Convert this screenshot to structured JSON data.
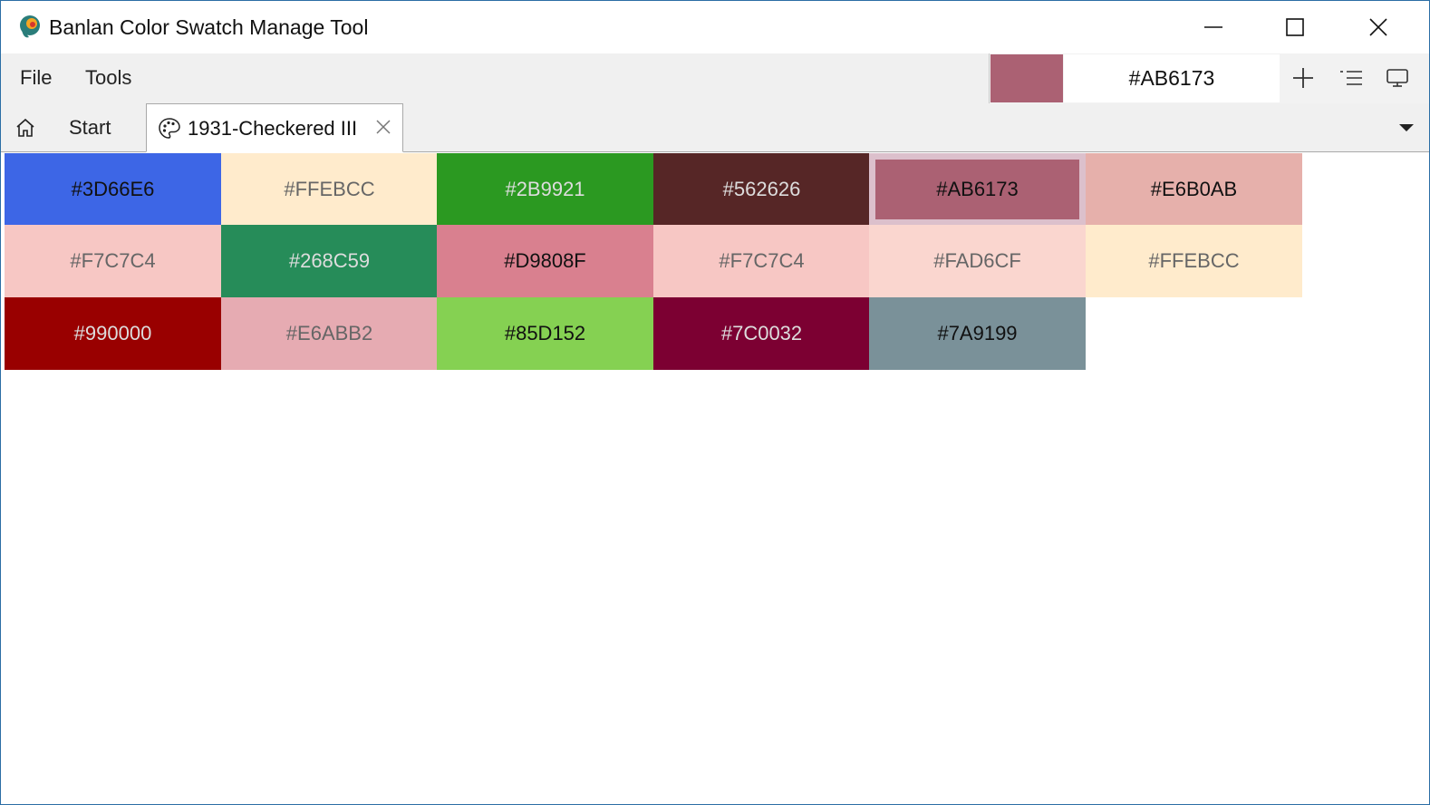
{
  "window": {
    "title": "Banlan Color Swatch Manage Tool",
    "icon": "banlan-logo-icon",
    "controls": [
      "minimize-icon",
      "maximize-icon",
      "close-icon"
    ]
  },
  "menu": {
    "file": "File",
    "tools": "Tools"
  },
  "toolbar": {
    "current_color": "#AB6173",
    "hex_value": "#AB6173",
    "icons": [
      "add-icon",
      "list-view-icon",
      "display-icon"
    ]
  },
  "tabs": {
    "start": {
      "label": "Start",
      "icon": "home-icon"
    },
    "active": {
      "label": "1931-Checkered III",
      "icon": "palette-icon",
      "close": "close-tab-icon"
    },
    "dropdown": "chevron-down-icon"
  },
  "swatches": [
    {
      "hex": "#3D66E6",
      "bg": "#3D66E6",
      "fg": "#111111"
    },
    {
      "hex": "#FFEBCC",
      "bg": "#FFEBCC",
      "fg": "#666666"
    },
    {
      "hex": "#2B9921",
      "bg": "#2B9921",
      "fg": "#dddddd"
    },
    {
      "hex": "#562626",
      "bg": "#562626",
      "fg": "#dddddd"
    },
    {
      "hex": "#AB6173",
      "bg": "#AB6173",
      "fg": "#111111",
      "selected": true
    },
    {
      "hex": "#E6B0AB",
      "bg": "#E6B0AB",
      "fg": "#111111"
    },
    {
      "hex": "#F7C7C4",
      "bg": "#F7C7C4",
      "fg": "#666666"
    },
    {
      "hex": "#268C59",
      "bg": "#268C59",
      "fg": "#dddddd"
    },
    {
      "hex": "#D9808F",
      "bg": "#D9808F",
      "fg": "#111111"
    },
    {
      "hex": "#F7C7C4",
      "bg": "#F7C7C4",
      "fg": "#666666"
    },
    {
      "hex": "#FAD6CF",
      "bg": "#FAD6CF",
      "fg": "#666666"
    },
    {
      "hex": "#FFEBCC",
      "bg": "#FFEBCC",
      "fg": "#666666"
    },
    {
      "hex": "#990000",
      "bg": "#990000",
      "fg": "#dddddd"
    },
    {
      "hex": "#E6ABB2",
      "bg": "#E6ABB2",
      "fg": "#666666"
    },
    {
      "hex": "#85D152",
      "bg": "#85D152",
      "fg": "#111111"
    },
    {
      "hex": "#7C0032",
      "bg": "#7C0032",
      "fg": "#dddddd"
    },
    {
      "hex": "#7A9199",
      "bg": "#7A9199",
      "fg": "#111111"
    }
  ],
  "accent": "#2b6ea5"
}
